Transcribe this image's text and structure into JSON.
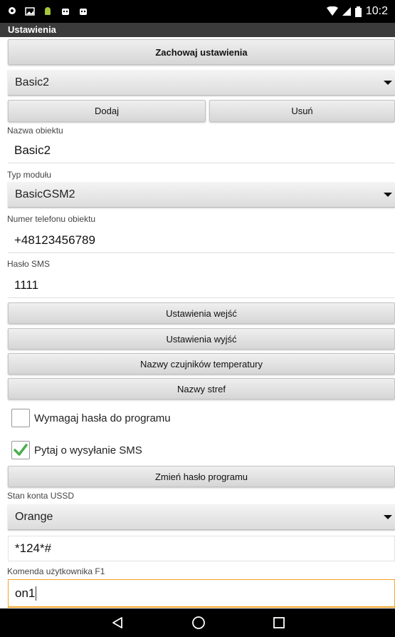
{
  "status_bar": {
    "time": "10:2",
    "icons": [
      "location-icon",
      "image-icon",
      "android-icon",
      "robot-icon",
      "robot-icon"
    ]
  },
  "app": {
    "title": "Ustawienia"
  },
  "buttons": {
    "save": "Zachowaj ustawienia",
    "add": "Dodaj",
    "remove": "Usuń",
    "inputs_settings": "Ustawienia wejść",
    "outputs_settings": "Ustawienia wyjść",
    "temp_sensor_names": "Nazwy czujników temperatury",
    "zone_names": "Nazwy stref",
    "change_password": "Zmień hasło programu"
  },
  "profile_select": {
    "value": "Basic2"
  },
  "fields": {
    "object_name": {
      "label": "Nazwa obiektu",
      "value": "Basic2"
    },
    "module_type": {
      "label": "Typ modułu",
      "value": "BasicGSM2"
    },
    "phone_number": {
      "label": "Numer telefonu obiektu",
      "value": "+48123456789"
    },
    "sms_password": {
      "label": "Hasło SMS",
      "value": "1111"
    },
    "ussd": {
      "label": "Stan konta USSD",
      "operator": "Orange",
      "code": "*124*#"
    },
    "command_f1": {
      "label": "Komenda użytkownika F1",
      "value": "on1"
    }
  },
  "checkboxes": {
    "require_password": {
      "label": "Wymagaj hasła do programu",
      "checked": false
    },
    "ask_sms": {
      "label": "Pytaj o wysyłanie SMS",
      "checked": true
    }
  },
  "colors": {
    "accent": "#f5a32d",
    "check": "#4caf50"
  }
}
